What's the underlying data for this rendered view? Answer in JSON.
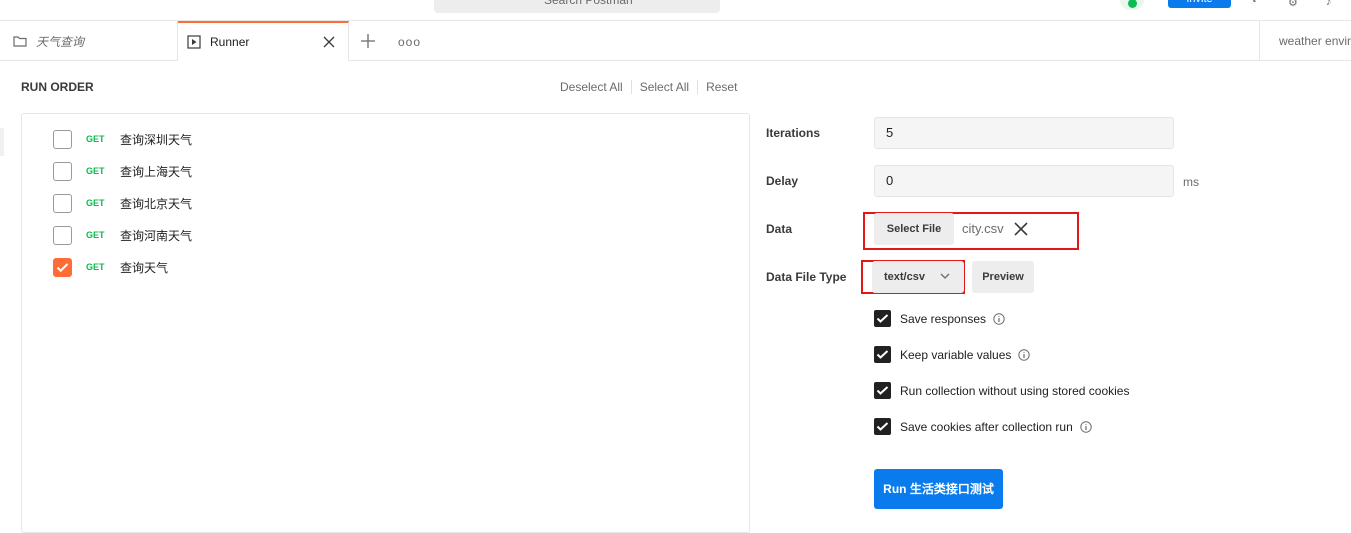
{
  "topbar": {
    "search_placeholder": "Search Postman",
    "invite_label": "Invite"
  },
  "tabs": [
    {
      "label": "天气查询",
      "icon": "folder-icon"
    },
    {
      "label": "Runner",
      "icon": "runner-play-icon"
    }
  ],
  "tab_more": "ooo",
  "environment": {
    "label": "weather envir"
  },
  "run_order": {
    "title": "RUN ORDER",
    "actions": [
      "Deselect All",
      "Select All",
      "Reset"
    ],
    "requests": [
      {
        "method": "GET",
        "name": "查询深圳天气",
        "checked": false
      },
      {
        "method": "GET",
        "name": "查询上海天气",
        "checked": false
      },
      {
        "method": "GET",
        "name": "查询北京天气",
        "checked": false
      },
      {
        "method": "GET",
        "name": "查询河南天气",
        "checked": false
      },
      {
        "method": "GET",
        "name": "查询天气",
        "checked": true
      }
    ]
  },
  "config": {
    "iterations_label": "Iterations",
    "iterations_value": "5",
    "delay_label": "Delay",
    "delay_value": "0",
    "delay_unit": "ms",
    "data_label": "Data",
    "select_file_label": "Select File",
    "file_name": "city.csv",
    "data_file_type_label": "Data File Type",
    "data_file_type_value": "text/csv",
    "preview_label": "Preview",
    "options": [
      {
        "label": "Save responses",
        "checked": true,
        "info": true
      },
      {
        "label": "Keep variable values",
        "checked": true,
        "info": true
      },
      {
        "label": "Run collection without using stored cookies",
        "checked": true,
        "info": false
      },
      {
        "label": "Save cookies after collection run",
        "checked": true,
        "info": true
      }
    ],
    "run_button_label": "Run 生活类接口测试"
  },
  "colors": {
    "accent_orange": "#ff6c37",
    "primary_blue": "#097bed",
    "get_green": "#0cbb52",
    "highlight_red": "#e01818"
  }
}
